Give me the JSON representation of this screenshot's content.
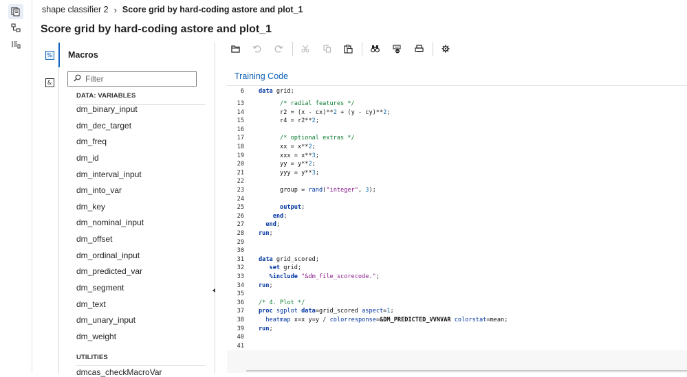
{
  "rail": {
    "items": [
      {
        "name": "sas-program-icon",
        "active": true
      },
      {
        "name": "pipeline-icon",
        "active": false
      },
      {
        "name": "node-list-icon",
        "active": false
      }
    ]
  },
  "breadcrumb": {
    "parent": "shape classifier 2",
    "separator": "›",
    "current": "Score grid by hard-coding astore and plot_1"
  },
  "page_title": "Score grid by hard-coding astore and plot_1",
  "side_tabs": [
    {
      "icon": "macros-tab-icon",
      "glyph": "%",
      "active": true
    },
    {
      "icon": "macro-variables-tab-icon",
      "glyph": "&",
      "active": false
    }
  ],
  "macros_panel": {
    "title": "Macros",
    "filter_placeholder": "Filter",
    "section_data": "DATA: VARIABLES",
    "variables": [
      "dm_binary_input",
      "dm_dec_target",
      "dm_freq",
      "dm_id",
      "dm_interval_input",
      "dm_into_var",
      "dm_key",
      "dm_nominal_input",
      "dm_offset",
      "dm_ordinal_input",
      "dm_predicted_var",
      "dm_segment",
      "dm_text",
      "dm_unary_input",
      "dm_weight"
    ],
    "section_utilities": "UTILITIES",
    "truncated_item": "dmcas_checkMacroVar"
  },
  "toolbar": [
    {
      "name": "open-icon",
      "enabled": true
    },
    {
      "name": "undo-icon",
      "enabled": false
    },
    {
      "name": "redo-icon",
      "enabled": false
    },
    {
      "name": "cut-icon",
      "enabled": false
    },
    {
      "name": "copy-icon",
      "enabled": false
    },
    {
      "name": "paste-icon",
      "enabled": true
    },
    {
      "name": "find-icon",
      "enabled": true
    },
    {
      "name": "clear-icon",
      "enabled": true
    },
    {
      "name": "print-icon",
      "enabled": true
    },
    {
      "name": "settings-icon",
      "enabled": true
    }
  ],
  "editor": {
    "tab_label": "Training Code",
    "lines": [
      {
        "n": "6",
        "code": "data grid;"
      },
      {
        "n": "13",
        "code": "      /* radial features */"
      },
      {
        "n": "14",
        "code": "      r2 = (x - cx)**2 + (y - cy)**2;"
      },
      {
        "n": "15",
        "code": "      r4 = r2**2;"
      },
      {
        "n": "16",
        "code": ""
      },
      {
        "n": "17",
        "code": "      /* optional extras */"
      },
      {
        "n": "18",
        "code": "      xx = x**2;"
      },
      {
        "n": "19",
        "code": "      xxx = x**3;"
      },
      {
        "n": "20",
        "code": "      yy = y**2;"
      },
      {
        "n": "21",
        "code": "      yyy = y**3;"
      },
      {
        "n": "22",
        "code": ""
      },
      {
        "n": "23",
        "code": "      group = rand(\"integer\", 3);"
      },
      {
        "n": "24",
        "code": ""
      },
      {
        "n": "25",
        "code": "      output;"
      },
      {
        "n": "26",
        "code": "    end;"
      },
      {
        "n": "27",
        "code": "  end;"
      },
      {
        "n": "28",
        "code": "run;"
      },
      {
        "n": "29",
        "code": ""
      },
      {
        "n": "30",
        "code": ""
      },
      {
        "n": "31",
        "code": "data grid_scored;"
      },
      {
        "n": "32",
        "code": "   set grid;"
      },
      {
        "n": "33",
        "code": "   %include \"&dm_file_scorecode.\";"
      },
      {
        "n": "34",
        "code": "run;"
      },
      {
        "n": "35",
        "code": ""
      },
      {
        "n": "36",
        "code": "/* 4. Plot */"
      },
      {
        "n": "37",
        "code": "proc sgplot data=grid_scored aspect=1;"
      },
      {
        "n": "38",
        "code": "  heatmap x=x y=y / colorresponse=&DM_PREDICTED_VVNVAR colorstat=mean;"
      },
      {
        "n": "39",
        "code": "run;"
      },
      {
        "n": "40",
        "code": ""
      },
      {
        "n": "41",
        "code": ""
      }
    ]
  },
  "colors": {
    "accent": "#0f63b8",
    "comment": "#0a7d2f",
    "keyword": "#0033a0",
    "string": "#8a1a8a"
  }
}
